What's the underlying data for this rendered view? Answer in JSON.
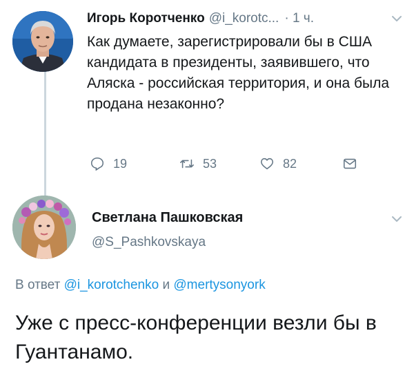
{
  "tweet1": {
    "author_name": "Игорь Коротченко",
    "handle": "@i_korotc...",
    "time": "· 1 ч.",
    "text": "Как думаете, зарегистрировали бы в США кандидата в президенты, заявившего, что Аляска - российская территория, и она была продана незаконно?",
    "actions": {
      "replies": "19",
      "retweets": "53",
      "likes": "82"
    }
  },
  "tweet2": {
    "author_name": "Светлана Пашковская",
    "handle": "@S_Pashkovskaya",
    "reply_prefix": "В ответ",
    "reply_user1": "@i_korotchenko",
    "reply_and": "и",
    "reply_user2": "@mertysonyork",
    "text": "Уже с пресс-конференции везли бы в Гуантанамо."
  },
  "colors": {
    "text": "#14171a",
    "secondary": "#657786",
    "link": "#1b95e0",
    "thread_line": "#ccd6dd"
  },
  "icons": {
    "reply": "reply-icon",
    "retweet": "retweet-icon",
    "like": "heart-icon",
    "dm": "envelope-icon",
    "menu": "chevron-down-icon"
  }
}
